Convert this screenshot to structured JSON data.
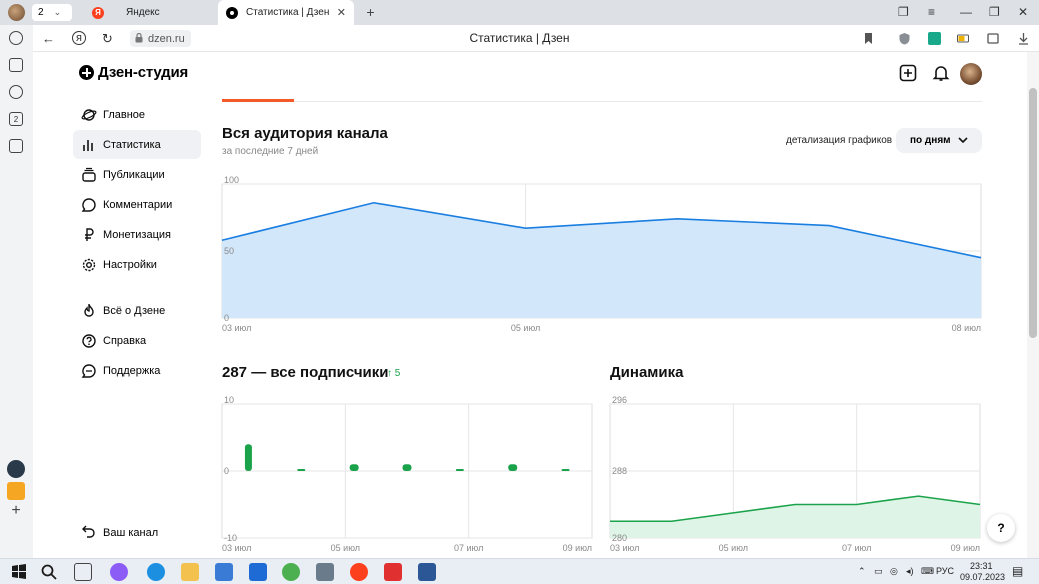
{
  "browser": {
    "tab_count": "2",
    "tabs": [
      {
        "label": "Яндекс"
      },
      {
        "label": "Статистика | Дзен"
      }
    ],
    "url": "dzen.ru",
    "page_title": "Статистика | Дзен"
  },
  "brand": {
    "name": "Дзен-студия"
  },
  "menu": {
    "items": [
      {
        "label": "Главное"
      },
      {
        "label": "Статистика"
      },
      {
        "label": "Публикации"
      },
      {
        "label": "Комментарии"
      },
      {
        "label": "Монетизация"
      },
      {
        "label": "Настройки"
      },
      {
        "label": "Всё о Дзене"
      },
      {
        "label": "Справка"
      },
      {
        "label": "Поддержка"
      }
    ],
    "your_channel": "Ваш канал"
  },
  "audience": {
    "title": "Вся аудитория канала",
    "subtitle": "за последние 7 дней",
    "detail_label": "детализация графиков",
    "detail_value": "по дням"
  },
  "subscribers": {
    "title": "287 — все подписчики",
    "delta": "5"
  },
  "dynamics": {
    "title": "Динамика"
  },
  "help": "?",
  "taskbar": {
    "lang": "РУС",
    "time": "23:31",
    "date": "09.07.2023"
  },
  "colors": {
    "accent_orange": "#f25a29",
    "audience_line": "#1a7ee0",
    "audience_fill": "#d3e7fb",
    "green": "#1aa34a",
    "green_fill": "#def4e6"
  },
  "chart_data": [
    {
      "type": "area",
      "x": [
        "03 июл",
        "04 июл",
        "05 июл",
        "06 июл",
        "07 июл",
        "08 июл"
      ],
      "y": [
        58,
        86,
        67,
        74,
        69,
        45
      ],
      "ylim": [
        0,
        100
      ],
      "yticks": [
        "100",
        "50",
        "0"
      ],
      "xticks": [
        "03 июл",
        "05 июл",
        "08 июл"
      ],
      "grid": true
    },
    {
      "type": "bar",
      "x": [
        "03 июл",
        "04 июл",
        "05 июл",
        "06 июл",
        "07 июл",
        "08 июл",
        "09 июл"
      ],
      "y": [
        4,
        0,
        1,
        1,
        0,
        1,
        0
      ],
      "ylim": [
        -10,
        10
      ],
      "yticks": [
        "10",
        "0",
        "-10"
      ],
      "xticks": [
        "03 июл",
        "05 июл",
        "07 июл",
        "09 июл"
      ],
      "grid": true
    },
    {
      "type": "area",
      "x": [
        "03 июл",
        "04 июл",
        "05 июл",
        "06 июл",
        "07 июл",
        "08 июл",
        "09 июл"
      ],
      "y": [
        282,
        282,
        283,
        284,
        284,
        285,
        284
      ],
      "ylim": [
        280,
        296
      ],
      "yticks": [
        "296",
        "288",
        "280"
      ],
      "xticks": [
        "03 июл",
        "05 июл",
        "07 июл",
        "09 июл"
      ],
      "grid": true
    }
  ]
}
